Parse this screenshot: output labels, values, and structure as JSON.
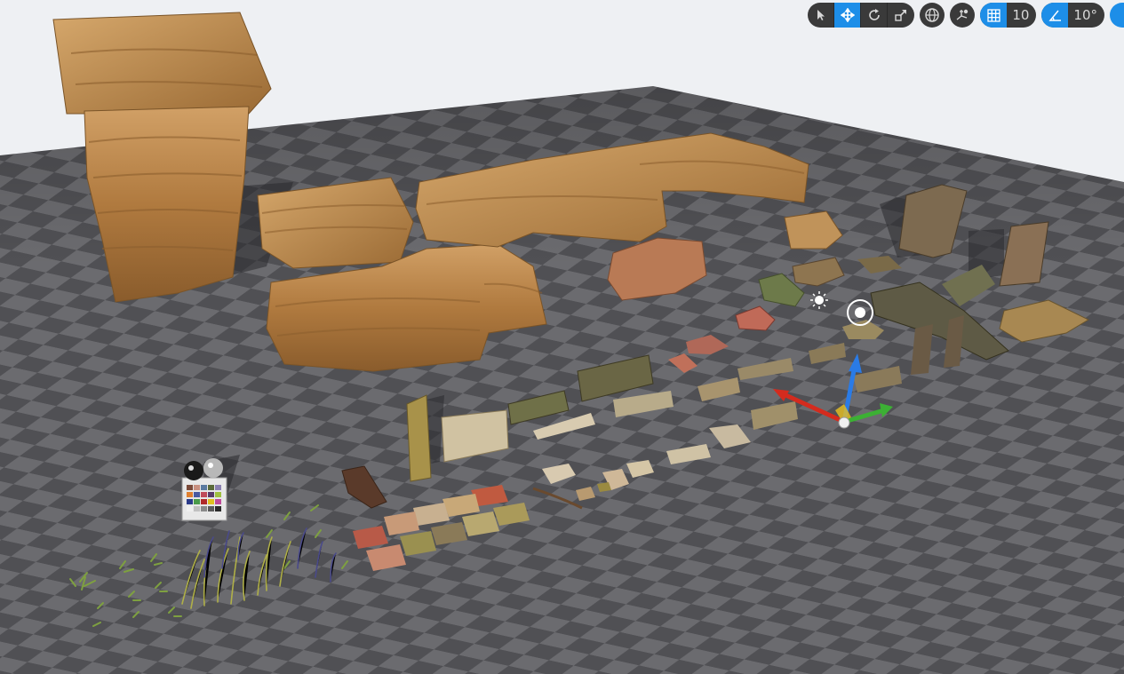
{
  "viewport": {
    "name": "level-viewport"
  },
  "toolbar": {
    "tools": [
      {
        "name": "select-mode-button",
        "icon": "cursor-arrow-icon",
        "active": false
      },
      {
        "name": "translate-mode-button",
        "icon": "move-arrows-icon",
        "active": true
      },
      {
        "name": "rotate-mode-button",
        "icon": "rotate-icon",
        "active": false
      },
      {
        "name": "scale-mode-button",
        "icon": "scale-icon",
        "active": false
      }
    ],
    "world_local_icon": "globe-icon",
    "surface_snap_icon": "surface-snap-icon",
    "grid_snap": {
      "icon": "grid-icon",
      "value": "10"
    },
    "rotation_snap": {
      "icon": "angle-icon",
      "value": "10°"
    }
  },
  "colors": {
    "accent": "#1d8ee8",
    "toolbar_bg": "#3a3a3a",
    "floor_light": "#6c6c70",
    "floor_dark": "#4e4e52",
    "sky": "#f0f1f4",
    "rock": "#b8874c",
    "gizmo_x": "#d42b1e",
    "gizmo_y": "#3cb034",
    "gizmo_z": "#2a7be6"
  }
}
